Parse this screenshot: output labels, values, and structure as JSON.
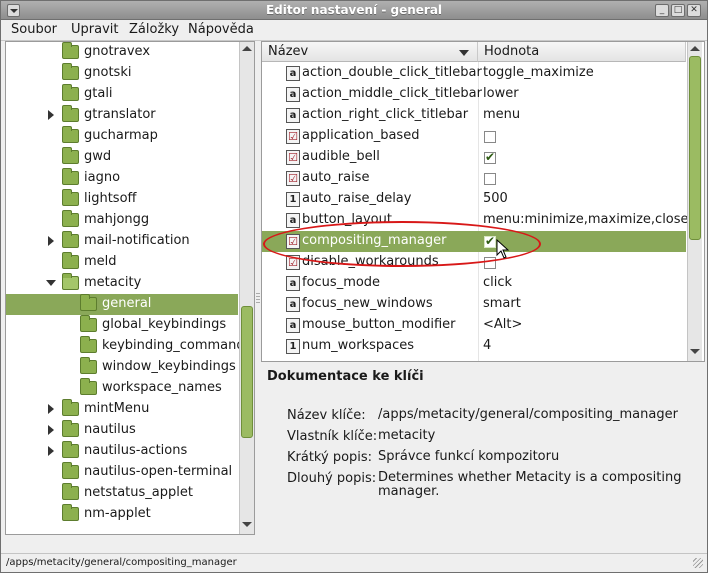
{
  "window": {
    "title": "Editor nastavení - general",
    "buttons": {
      "minimize": "_",
      "maximize": "□",
      "close": "✕"
    }
  },
  "menubar": [
    "Soubor",
    "Upravit",
    "Záložky",
    "Nápověda"
  ],
  "tree": {
    "items": [
      {
        "label": "gnotravex",
        "indent": 1,
        "expander": "none"
      },
      {
        "label": "gnotski",
        "indent": 1,
        "expander": "none"
      },
      {
        "label": "gtali",
        "indent": 1,
        "expander": "none"
      },
      {
        "label": "gtranslator",
        "indent": 1,
        "expander": "collapsed"
      },
      {
        "label": "gucharmap",
        "indent": 1,
        "expander": "none"
      },
      {
        "label": "gwd",
        "indent": 1,
        "expander": "none"
      },
      {
        "label": "iagno",
        "indent": 1,
        "expander": "none"
      },
      {
        "label": "lightsoff",
        "indent": 1,
        "expander": "none"
      },
      {
        "label": "mahjongg",
        "indent": 1,
        "expander": "none"
      },
      {
        "label": "mail-notification",
        "indent": 1,
        "expander": "collapsed"
      },
      {
        "label": "meld",
        "indent": 1,
        "expander": "none"
      },
      {
        "label": "metacity",
        "indent": 1,
        "expander": "expanded"
      },
      {
        "label": "general",
        "indent": 2,
        "expander": "none",
        "selected": true
      },
      {
        "label": "global_keybindings",
        "indent": 2,
        "expander": "none"
      },
      {
        "label": "keybinding_command",
        "indent": 2,
        "expander": "none"
      },
      {
        "label": "window_keybindings",
        "indent": 2,
        "expander": "none"
      },
      {
        "label": "workspace_names",
        "indent": 2,
        "expander": "none"
      },
      {
        "label": "mintMenu",
        "indent": 1,
        "expander": "collapsed"
      },
      {
        "label": "nautilus",
        "indent": 1,
        "expander": "collapsed"
      },
      {
        "label": "nautilus-actions",
        "indent": 1,
        "expander": "collapsed"
      },
      {
        "label": "nautilus-open-terminal",
        "indent": 1,
        "expander": "none"
      },
      {
        "label": "netstatus_applet",
        "indent": 1,
        "expander": "none"
      },
      {
        "label": "nm-applet",
        "indent": 1,
        "expander": "none"
      }
    ]
  },
  "table": {
    "headers": {
      "name": "Název",
      "value": "Hodnota"
    },
    "rows": [
      {
        "name": "action_double_click_titlebar",
        "type": "string",
        "value": "toggle_maximize"
      },
      {
        "name": "action_middle_click_titlebar",
        "type": "string",
        "value": "lower"
      },
      {
        "name": "action_right_click_titlebar",
        "type": "string",
        "value": "menu"
      },
      {
        "name": "application_based",
        "type": "bool",
        "checked": false
      },
      {
        "name": "audible_bell",
        "type": "bool",
        "checked": true
      },
      {
        "name": "auto_raise",
        "type": "bool",
        "checked": false
      },
      {
        "name": "auto_raise_delay",
        "type": "int",
        "value": "500"
      },
      {
        "name": "button_layout",
        "type": "string",
        "value": "menu:minimize,maximize,close"
      },
      {
        "name": "compositing_manager",
        "type": "bool",
        "checked": true,
        "selected": true
      },
      {
        "name": "disable_workarounds",
        "type": "bool",
        "checked": false
      },
      {
        "name": "focus_mode",
        "type": "string",
        "value": "click"
      },
      {
        "name": "focus_new_windows",
        "type": "string",
        "value": "smart"
      },
      {
        "name": "mouse_button_modifier",
        "type": "string",
        "value": "<Alt>"
      },
      {
        "name": "num_workspaces",
        "type": "int",
        "value": "4"
      }
    ]
  },
  "type_icons": {
    "string": "a",
    "bool": "☑",
    "int": "1"
  },
  "documentation": {
    "title": "Dokumentace ke klíči",
    "fields": [
      {
        "label": "Název klíče:",
        "value": "/apps/metacity/general/compositing_manager"
      },
      {
        "label": "Vlastník klíče:",
        "value": "metacity"
      },
      {
        "label": "Krátký popis:",
        "value": "Správce funkcí kompozitoru"
      },
      {
        "label": "Dlouhý popis:",
        "value": "Determines whether Metacity is a compositing manager."
      }
    ]
  },
  "statusbar": {
    "path": "/apps/metacity/general/compositing_manager"
  },
  "colors": {
    "selection": "#8aa859",
    "folder": "#8cb04e",
    "annotation": "#d81818"
  }
}
